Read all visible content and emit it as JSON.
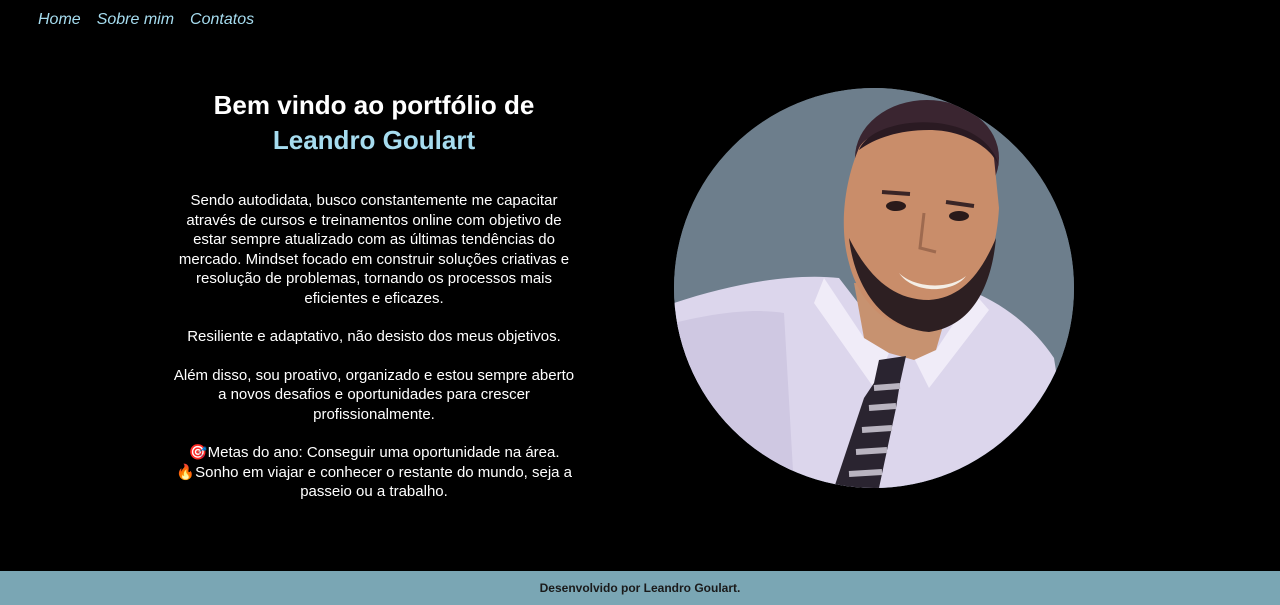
{
  "nav": {
    "items": [
      {
        "label": "Home"
      },
      {
        "label": "Sobre mim"
      },
      {
        "label": "Contatos"
      }
    ]
  },
  "hero": {
    "title_line1": "Bem vindo ao portfólio de",
    "title_name": "Leandro Goulart",
    "bio_paragraph1": "Sendo autodidata, busco constantemente me capacitar através de cursos e treinamentos online com objetivo de estar sempre atualizado com as últimas tendências do mercado. Mindset focado em construir soluções criativas e resolução de problemas, tornando os processos mais eficientes e eficazes.",
    "bio_paragraph2": "Resiliente e adaptativo, não desisto dos meus objetivos.",
    "bio_paragraph3": "Além disso, sou proativo, organizado e estou sempre aberto a novos desafios e oportunidades para crescer profissionalmente.",
    "goals_text": "Metas do ano: Conseguir uma oportunidade na área.",
    "dream_text": "Sonho em viajar e conhecer o restante do mundo, seja a passeio ou a trabalho.",
    "goals_icon": "🎯",
    "dream_icon": "🔥"
  },
  "footer": {
    "text": "Desenvolvido por Leandro Goulart."
  },
  "colors": {
    "background": "#000000",
    "accent": "#a6dcef",
    "footer_bg": "#7aa6b4"
  }
}
